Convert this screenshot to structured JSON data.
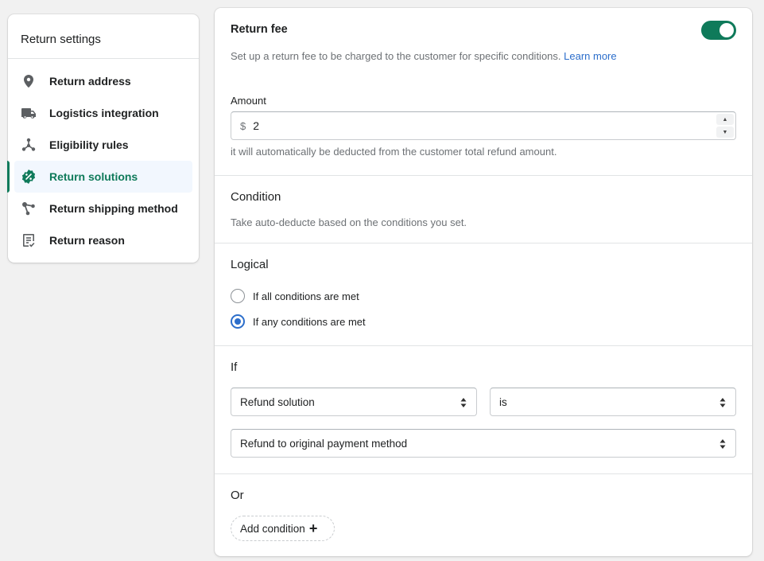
{
  "sidebar": {
    "title": "Return settings",
    "items": [
      {
        "label": "Return address",
        "icon": "location-pin-icon"
      },
      {
        "label": "Logistics integration",
        "icon": "truck-icon"
      },
      {
        "label": "Eligibility rules",
        "icon": "network-nodes-icon"
      },
      {
        "label": "Return solutions",
        "icon": "discount-badge-icon",
        "active": true
      },
      {
        "label": "Return shipping method",
        "icon": "share-nodes-icon"
      },
      {
        "label": "Return reason",
        "icon": "checklist-icon"
      }
    ]
  },
  "return_fee": {
    "title": "Return fee",
    "enabled": true,
    "description": "Set up a return fee to be charged to the customer for specific conditions.",
    "learn_more": "Learn more",
    "amount_label": "Amount",
    "currency_prefix": "$",
    "amount_value": "2",
    "amount_help": "it will automatically be deducted from the customer total refund amount."
  },
  "condition": {
    "title": "Condition",
    "description": "Take auto-deducte based on the conditions you set."
  },
  "logical": {
    "title": "Logical",
    "options": [
      {
        "label": "If all conditions are met",
        "checked": false
      },
      {
        "label": "If any conditions are met",
        "checked": true
      }
    ]
  },
  "if_block": {
    "title": "If",
    "field_select": "Refund solution",
    "operator_select": "is",
    "value_select": "Refund to original payment method"
  },
  "or_block": {
    "title": "Or",
    "add_condition": "Add condition"
  },
  "colors": {
    "accent_green": "#0f7a5a",
    "link_blue": "#2c6ecb",
    "radio_blue": "#2c6ecb"
  }
}
